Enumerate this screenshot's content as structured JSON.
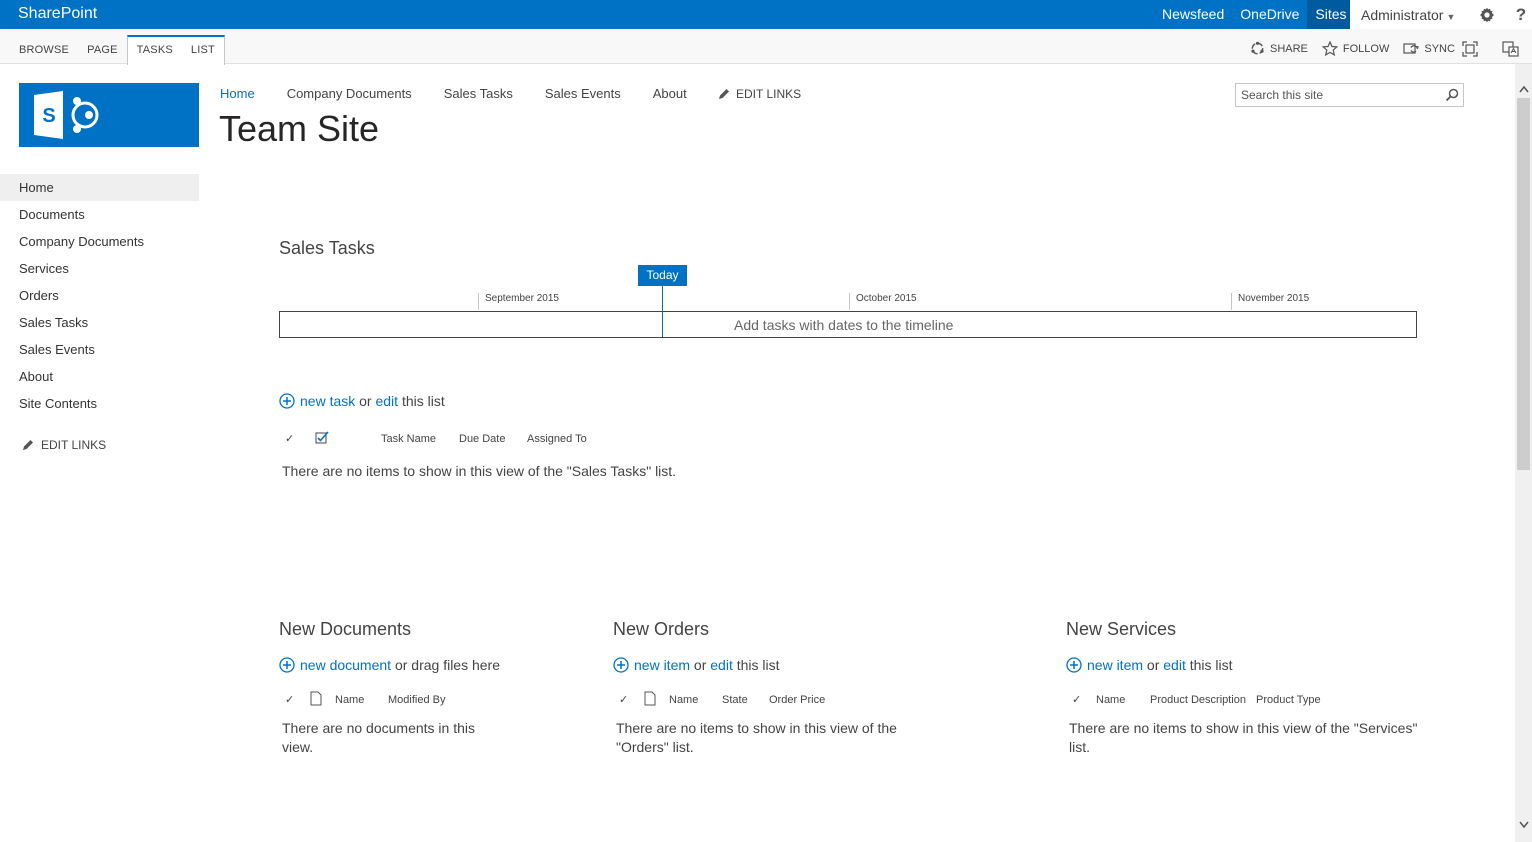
{
  "suite_bar": {
    "brand": "SharePoint",
    "links": [
      "Newsfeed",
      "OneDrive",
      "Sites"
    ],
    "active_link": "Sites",
    "user": "Administrator",
    "settings_icon": "gear-icon",
    "help_icon": "question-mark-icon"
  },
  "ribbon": {
    "tabs": [
      "BROWSE",
      "PAGE",
      "TASKS",
      "LIST"
    ],
    "contextual_tabs": [
      "TASKS",
      "LIST"
    ],
    "actions": [
      "SHARE",
      "FOLLOW",
      "SYNC"
    ]
  },
  "header": {
    "top_nav": [
      "Home",
      "Company Documents",
      "Sales Tasks",
      "Sales Events",
      "About"
    ],
    "active_nav": "Home",
    "edit_links": "EDIT LINKS",
    "site_title": "Team Site",
    "search_placeholder": "Search this site"
  },
  "left_nav": {
    "items": [
      "Home",
      "Documents",
      "Company Documents",
      "Services",
      "Orders",
      "Sales Tasks",
      "Sales Events",
      "About",
      "Site Contents"
    ],
    "selected": "Home",
    "edit_links": "EDIT LINKS"
  },
  "sales_tasks": {
    "title": "Sales Tasks",
    "today_label": "Today",
    "months": [
      "September 2015",
      "October 2015",
      "November 2015"
    ],
    "timeline_message": "Add tasks with dates to the timeline",
    "new_link": "new task",
    "or_text": "or",
    "edit_link": "edit",
    "suffix_text": "this list",
    "columns": [
      "Task Name",
      "Due Date",
      "Assigned To"
    ],
    "empty_message": "There are no items to show in this view of the \"Sales Tasks\" list."
  },
  "new_documents": {
    "title": "New Documents",
    "new_link": "new document",
    "suffix_text": "or drag files here",
    "columns": [
      "Name",
      "Modified By"
    ],
    "empty_message": "There are no documents in this view."
  },
  "new_orders": {
    "title": "New Orders",
    "new_link": "new item",
    "or_text": "or",
    "edit_link": "edit",
    "suffix_text": "this list",
    "columns": [
      "Name",
      "State",
      "Order Price"
    ],
    "empty_message": "There are no items to show in this view of the \"Orders\" list."
  },
  "new_services": {
    "title": "New Services",
    "new_link": "new item",
    "or_text": "or",
    "edit_link": "edit",
    "suffix_text": "this list",
    "columns": [
      "Name",
      "Product Description",
      "Product Type"
    ],
    "empty_message": "There are no items to show in this view of the \"Services\" list."
  },
  "colors": {
    "brand_blue": "#0072c6",
    "text": "#444444"
  }
}
